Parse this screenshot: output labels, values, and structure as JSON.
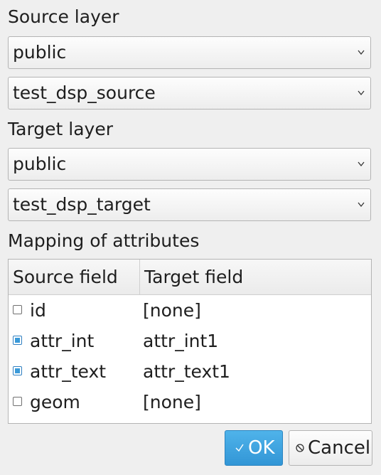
{
  "source": {
    "label": "Source layer",
    "schema": "public",
    "table": "test_dsp_source"
  },
  "target": {
    "label": "Target layer",
    "schema": "public",
    "table": "test_dsp_target"
  },
  "mapping": {
    "label": "Mapping of attributes",
    "columns": [
      "Source field",
      "Target field"
    ],
    "rows": [
      {
        "source": "id",
        "target": "[none]",
        "checked": false
      },
      {
        "source": "attr_int",
        "target": "attr_int1",
        "checked": true
      },
      {
        "source": "attr_text",
        "target": "attr_text1",
        "checked": true
      },
      {
        "source": "geom",
        "target": "[none]",
        "checked": false
      }
    ]
  },
  "buttons": {
    "ok": "OK",
    "cancel": "Cancel"
  },
  "colors": {
    "accent": "#3a9ad9"
  },
  "icons": {
    "ok": "checkmark-icon",
    "cancel": "cancel-icon",
    "dropdown": "chevron-down-icon"
  }
}
